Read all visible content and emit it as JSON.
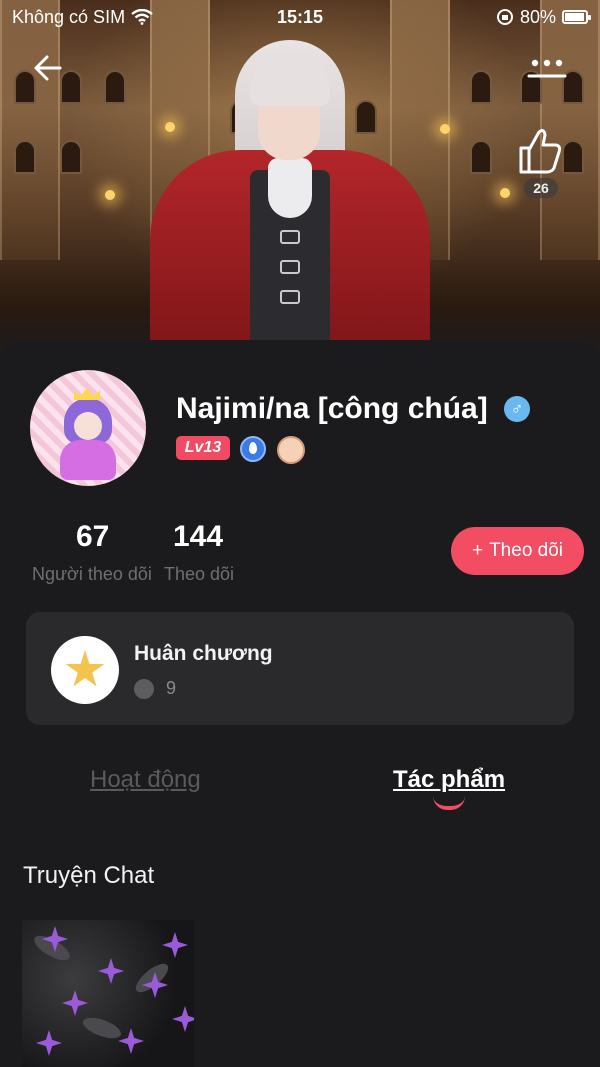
{
  "status_bar": {
    "carrier": "Không có SIM",
    "time": "15:15",
    "battery": "80%"
  },
  "hero": {
    "likes": "26"
  },
  "profile": {
    "name": "Najimi/na [công chúa]",
    "gender_symbol": "♂",
    "level_badge": "Lv13"
  },
  "stats": {
    "followers_count": "67",
    "followers_label": "Người theo dõi",
    "following_count": "144",
    "following_label": "Theo dõi",
    "follow_button": "Theo dõi",
    "follow_button_plus": "+"
  },
  "medal": {
    "title": "Huân chương",
    "count": "9"
  },
  "tabs": [
    {
      "label": "Hoạt động",
      "active": false
    },
    {
      "label": "Tác phẩm",
      "active": true
    }
  ],
  "section": {
    "title": "Truyện Chat"
  },
  "colors": {
    "accent": "#f34d64",
    "background": "#1b1b1d",
    "card": "#2a2a2d",
    "gender_badge": "#6ab8f0"
  }
}
